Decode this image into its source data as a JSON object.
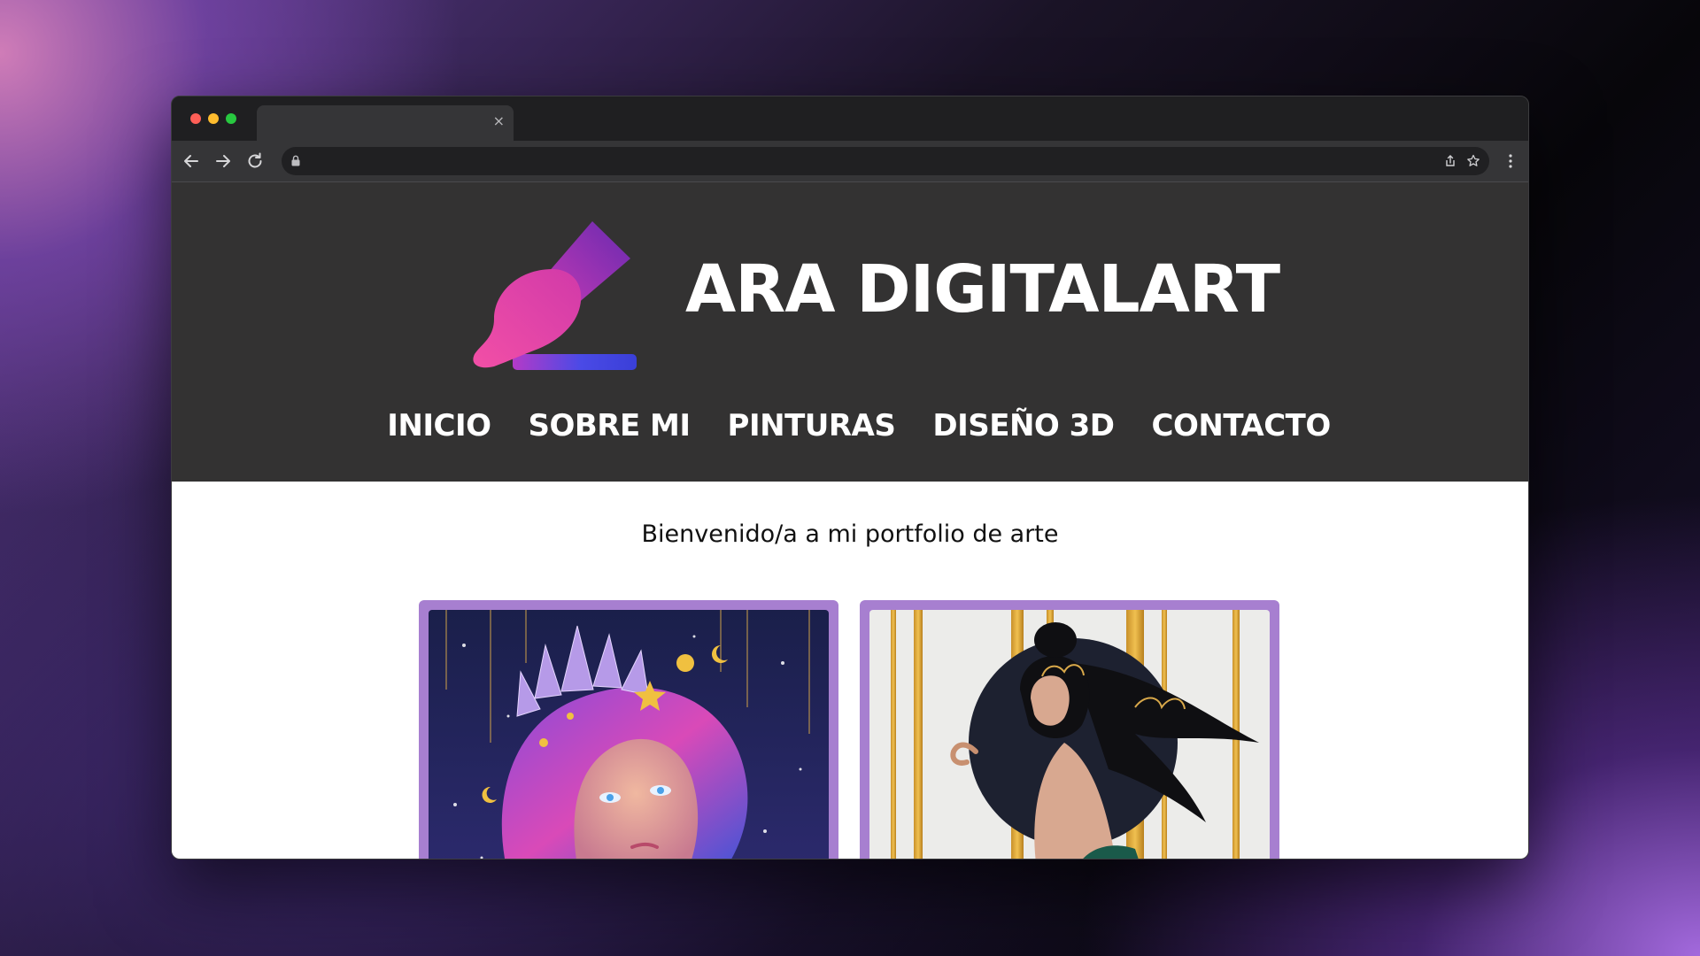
{
  "site": {
    "title": "ARA DIGITALART",
    "welcome": "Bienvenido/a a mi portfolio de arte"
  },
  "nav": {
    "items": [
      {
        "label": "INICIO"
      },
      {
        "label": "SOBRE MI"
      },
      {
        "label": "PINTURAS"
      },
      {
        "label": "DISEÑO 3D"
      },
      {
        "label": "CONTACTO"
      }
    ]
  },
  "browser": {
    "tab_close": "×",
    "url": ""
  },
  "gallery": {
    "items": [
      {
        "subject": "cosmic-crystal-portrait"
      },
      {
        "subject": "woman-with-gold-lotus"
      }
    ]
  },
  "icons": {
    "back": "arrow-left-icon",
    "forward": "arrow-right-icon",
    "reload": "reload-icon",
    "lock": "lock-icon",
    "share": "share-icon",
    "bookmark": "star-icon",
    "menu": "kebab-menu-icon",
    "logo": "paintbrush-logo-icon"
  },
  "colors": {
    "header_bg": "#333232",
    "card_border": "#a77fd0",
    "logo_pink": "#ec3fa1",
    "logo_purple": "#7a2fb8",
    "logo_blue": "#3d3fe0"
  }
}
